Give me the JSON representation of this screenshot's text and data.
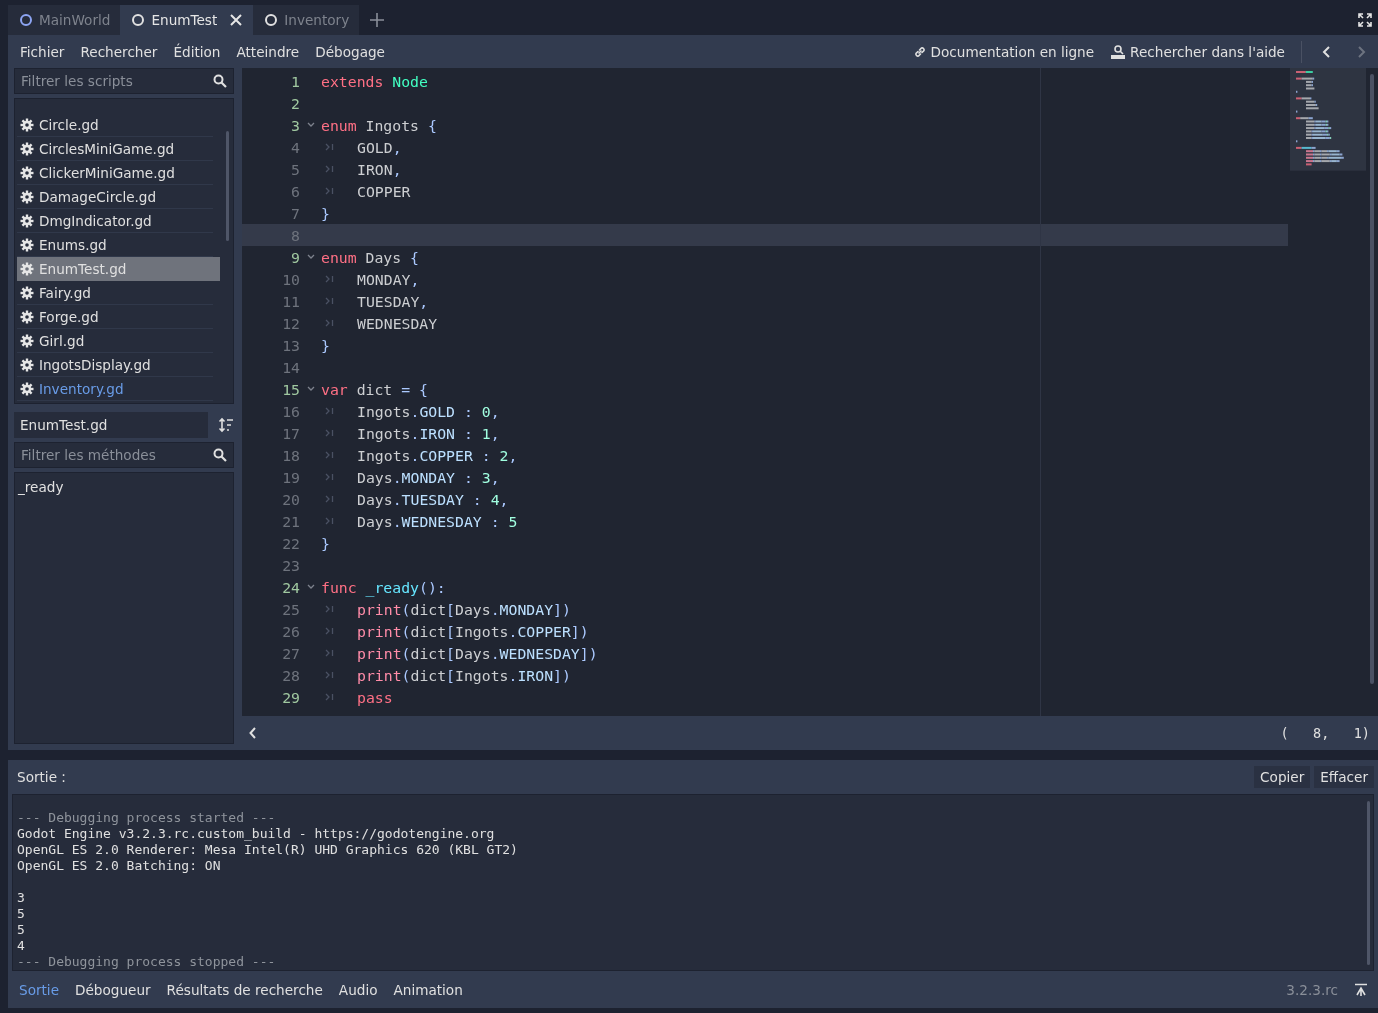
{
  "tabs": [
    {
      "label": "MainWorld",
      "selected": false,
      "color": "#8da5f3"
    },
    {
      "label": "EnumTest",
      "selected": true,
      "color": "#e0e0e0"
    },
    {
      "label": "Inventory",
      "selected": false,
      "color": "#e0e0e0"
    }
  ],
  "menu": [
    "Fichier",
    "Rechercher",
    "Édition",
    "Atteindre",
    "Débogage"
  ],
  "help_links": [
    {
      "label": "Documentation en ligne",
      "kind": "link"
    },
    {
      "label": "Rechercher dans l'aide",
      "kind": "search"
    }
  ],
  "history_nav": [
    {
      "disabled": false
    },
    {
      "disabled": true
    }
  ],
  "script_filter": {
    "placeholder": "Filtrer les scripts"
  },
  "scripts": [
    {
      "name": "Circle.gd",
      "selected": false,
      "highlighted": false
    },
    {
      "name": "CirclesMiniGame.gd",
      "selected": false,
      "highlighted": false
    },
    {
      "name": "ClickerMiniGame.gd",
      "selected": false,
      "highlighted": false
    },
    {
      "name": "DamageCircle.gd",
      "selected": false,
      "highlighted": false
    },
    {
      "name": "DmgIndicator.gd",
      "selected": false,
      "highlighted": false
    },
    {
      "name": "Enums.gd",
      "selected": false,
      "highlighted": false
    },
    {
      "name": "EnumTest.gd",
      "selected": true,
      "highlighted": false
    },
    {
      "name": "Fairy.gd",
      "selected": false,
      "highlighted": false
    },
    {
      "name": "Forge.gd",
      "selected": false,
      "highlighted": false
    },
    {
      "name": "Girl.gd",
      "selected": false,
      "highlighted": false
    },
    {
      "name": "IngotsDisplay.gd",
      "selected": false,
      "highlighted": false
    },
    {
      "name": "Inventory.gd",
      "selected": false,
      "highlighted": true
    }
  ],
  "current_script": "EnumTest.gd",
  "method_filter": {
    "placeholder": "Filtrer les méthodes"
  },
  "methods": [
    "_ready"
  ],
  "code_lines": [
    {
      "number": "1",
      "safe": true,
      "fold": false,
      "indent": false,
      "current": false,
      "tokens": [
        {
          "text": "extends",
          "kind": "keyword"
        },
        {
          "text": " Node",
          "kind": "type"
        }
      ]
    },
    {
      "number": "2",
      "safe": true,
      "fold": false,
      "indent": false,
      "current": false
    },
    {
      "number": "3",
      "safe": true,
      "fold": true,
      "indent": false,
      "current": false,
      "tokens": [
        {
          "text": "enum",
          "kind": "keyword"
        },
        {
          "text": " Ingots ",
          "kind": "plain"
        },
        {
          "text": "{",
          "kind": "symbol"
        }
      ]
    },
    {
      "number": "4",
      "safe": false,
      "fold": false,
      "indent": true,
      "current": false,
      "tokens": [
        {
          "text": "GOLD",
          "kind": "plain"
        },
        {
          "text": ",",
          "kind": "symbol"
        }
      ]
    },
    {
      "number": "5",
      "safe": false,
      "fold": false,
      "indent": true,
      "current": false,
      "tokens": [
        {
          "text": "IRON",
          "kind": "plain"
        },
        {
          "text": ",",
          "kind": "symbol"
        }
      ]
    },
    {
      "number": "6",
      "safe": false,
      "fold": false,
      "indent": true,
      "current": false,
      "tokens": [
        {
          "text": "COPPER",
          "kind": "plain"
        }
      ]
    },
    {
      "number": "7",
      "safe": false,
      "fold": false,
      "indent": false,
      "current": false,
      "tokens": [
        {
          "text": "}",
          "kind": "symbol"
        }
      ]
    },
    {
      "number": "8",
      "safe": false,
      "fold": false,
      "indent": false,
      "current": true
    },
    {
      "number": "9",
      "safe": true,
      "fold": true,
      "indent": false,
      "current": false,
      "tokens": [
        {
          "text": "enum",
          "kind": "keyword"
        },
        {
          "text": " Days ",
          "kind": "plain"
        },
        {
          "text": "{",
          "kind": "symbol"
        }
      ]
    },
    {
      "number": "10",
      "safe": false,
      "fold": false,
      "indent": true,
      "current": false,
      "tokens": [
        {
          "text": "MONDAY",
          "kind": "plain"
        },
        {
          "text": ",",
          "kind": "symbol"
        }
      ]
    },
    {
      "number": "11",
      "safe": false,
      "fold": false,
      "indent": true,
      "current": false,
      "tokens": [
        {
          "text": "TUESDAY",
          "kind": "plain"
        },
        {
          "text": ",",
          "kind": "symbol"
        }
      ]
    },
    {
      "number": "12",
      "safe": false,
      "fold": false,
      "indent": true,
      "current": false,
      "tokens": [
        {
          "text": "WEDNESDAY",
          "kind": "plain"
        }
      ]
    },
    {
      "number": "13",
      "safe": false,
      "fold": false,
      "indent": false,
      "current": false,
      "tokens": [
        {
          "text": "}",
          "kind": "symbol"
        }
      ]
    },
    {
      "number": "14",
      "safe": false,
      "fold": false,
      "indent": false,
      "current": false
    },
    {
      "number": "15",
      "safe": true,
      "fold": true,
      "indent": false,
      "current": false,
      "tokens": [
        {
          "text": "var",
          "kind": "keyword"
        },
        {
          "text": " dict ",
          "kind": "plain"
        },
        {
          "text": "= {",
          "kind": "symbol"
        }
      ]
    },
    {
      "number": "16",
      "safe": false,
      "fold": false,
      "indent": true,
      "current": false,
      "tokens": [
        {
          "text": "Ingots",
          "kind": "plain"
        },
        {
          "text": ".",
          "kind": "symbol"
        },
        {
          "text": "GOLD",
          "kind": "member"
        },
        {
          "text": " : ",
          "kind": "symbol"
        },
        {
          "text": "0",
          "kind": "number"
        },
        {
          "text": ",",
          "kind": "symbol"
        }
      ]
    },
    {
      "number": "17",
      "safe": false,
      "fold": false,
      "indent": true,
      "current": false,
      "tokens": [
        {
          "text": "Ingots",
          "kind": "plain"
        },
        {
          "text": ".",
          "kind": "symbol"
        },
        {
          "text": "IRON",
          "kind": "member"
        },
        {
          "text": " : ",
          "kind": "symbol"
        },
        {
          "text": "1",
          "kind": "number"
        },
        {
          "text": ",",
          "kind": "symbol"
        }
      ]
    },
    {
      "number": "18",
      "safe": false,
      "fold": false,
      "indent": true,
      "current": false,
      "tokens": [
        {
          "text": "Ingots",
          "kind": "plain"
        },
        {
          "text": ".",
          "kind": "symbol"
        },
        {
          "text": "COPPER",
          "kind": "member"
        },
        {
          "text": " : ",
          "kind": "symbol"
        },
        {
          "text": "2",
          "kind": "number"
        },
        {
          "text": ",",
          "kind": "symbol"
        }
      ]
    },
    {
      "number": "19",
      "safe": false,
      "fold": false,
      "indent": true,
      "current": false,
      "tokens": [
        {
          "text": "Days",
          "kind": "plain"
        },
        {
          "text": ".",
          "kind": "symbol"
        },
        {
          "text": "MONDAY",
          "kind": "member"
        },
        {
          "text": " : ",
          "kind": "symbol"
        },
        {
          "text": "3",
          "kind": "number"
        },
        {
          "text": ",",
          "kind": "symbol"
        }
      ]
    },
    {
      "number": "20",
      "safe": false,
      "fold": false,
      "indent": true,
      "current": false,
      "tokens": [
        {
          "text": "Days",
          "kind": "plain"
        },
        {
          "text": ".",
          "kind": "symbol"
        },
        {
          "text": "TUESDAY",
          "kind": "member"
        },
        {
          "text": " : ",
          "kind": "symbol"
        },
        {
          "text": "4",
          "kind": "number"
        },
        {
          "text": ",",
          "kind": "symbol"
        }
      ]
    },
    {
      "number": "21",
      "safe": false,
      "fold": false,
      "indent": true,
      "current": false,
      "tokens": [
        {
          "text": "Days",
          "kind": "plain"
        },
        {
          "text": ".",
          "kind": "symbol"
        },
        {
          "text": "WEDNESDAY",
          "kind": "member"
        },
        {
          "text": " : ",
          "kind": "symbol"
        },
        {
          "text": "5",
          "kind": "number"
        }
      ]
    },
    {
      "number": "22",
      "safe": false,
      "fold": false,
      "indent": false,
      "current": false,
      "tokens": [
        {
          "text": "}",
          "kind": "symbol"
        }
      ]
    },
    {
      "number": "23",
      "safe": false,
      "fold": false,
      "indent": false,
      "current": false
    },
    {
      "number": "24",
      "safe": true,
      "fold": true,
      "indent": false,
      "current": false,
      "tokens": [
        {
          "text": "func",
          "kind": "keyword"
        },
        {
          "text": " _ready",
          "kind": "function"
        },
        {
          "text": "():",
          "kind": "symbol"
        }
      ]
    },
    {
      "number": "25",
      "safe": false,
      "fold": false,
      "indent": true,
      "current": false,
      "tokens": [
        {
          "text": "print",
          "kind": "builtin"
        },
        {
          "text": "(",
          "kind": "symbol"
        },
        {
          "text": "dict",
          "kind": "plain"
        },
        {
          "text": "[",
          "kind": "symbol"
        },
        {
          "text": "Days",
          "kind": "plain"
        },
        {
          "text": ".",
          "kind": "symbol"
        },
        {
          "text": "MONDAY",
          "kind": "member"
        },
        {
          "text": "])",
          "kind": "symbol"
        }
      ]
    },
    {
      "number": "26",
      "safe": false,
      "fold": false,
      "indent": true,
      "current": false,
      "tokens": [
        {
          "text": "print",
          "kind": "builtin"
        },
        {
          "text": "(",
          "kind": "symbol"
        },
        {
          "text": "dict",
          "kind": "plain"
        },
        {
          "text": "[",
          "kind": "symbol"
        },
        {
          "text": "Ingots",
          "kind": "plain"
        },
        {
          "text": ".",
          "kind": "symbol"
        },
        {
          "text": "COPPER",
          "kind": "member"
        },
        {
          "text": "])",
          "kind": "symbol"
        }
      ]
    },
    {
      "number": "27",
      "safe": false,
      "fold": false,
      "indent": true,
      "current": false,
      "tokens": [
        {
          "text": "print",
          "kind": "builtin"
        },
        {
          "text": "(",
          "kind": "symbol"
        },
        {
          "text": "dict",
          "kind": "plain"
        },
        {
          "text": "[",
          "kind": "symbol"
        },
        {
          "text": "Days",
          "kind": "plain"
        },
        {
          "text": ".",
          "kind": "symbol"
        },
        {
          "text": "WEDNESDAY",
          "kind": "member"
        },
        {
          "text": "])",
          "kind": "symbol"
        }
      ]
    },
    {
      "number": "28",
      "safe": false,
      "fold": false,
      "indent": true,
      "current": false,
      "tokens": [
        {
          "text": "print",
          "kind": "builtin"
        },
        {
          "text": "(",
          "kind": "symbol"
        },
        {
          "text": "dict",
          "kind": "plain"
        },
        {
          "text": "[",
          "kind": "symbol"
        },
        {
          "text": "Ingots",
          "kind": "plain"
        },
        {
          "text": ".",
          "kind": "symbol"
        },
        {
          "text": "IRON",
          "kind": "member"
        },
        {
          "text": "])",
          "kind": "symbol"
        }
      ]
    },
    {
      "number": "29",
      "safe": true,
      "fold": false,
      "indent": true,
      "current": false,
      "tokens": [
        {
          "text": "pass",
          "kind": "keyword"
        }
      ]
    }
  ],
  "cursor_position": "(   8,   1)",
  "output": {
    "title": "Sortie :",
    "buttons": [
      "Copier",
      "Effacer"
    ],
    "lines": [
      {
        "text": "--- Debugging process started ---",
        "kind": "meta",
        "gap_before": false
      },
      {
        "text": "Godot Engine v3.2.3.rc.custom_build - https://godotengine.org",
        "kind": "text",
        "gap_before": false
      },
      {
        "text": "OpenGL ES 2.0 Renderer: Mesa Intel(R) UHD Graphics 620 (KBL GT2)",
        "kind": "text",
        "gap_before": false
      },
      {
        "text": "OpenGL ES 2.0 Batching: ON",
        "kind": "text",
        "gap_before": false
      },
      {
        "text": "3",
        "kind": "text",
        "gap_before": true
      },
      {
        "text": "5",
        "kind": "text",
        "gap_before": false
      },
      {
        "text": "5",
        "kind": "text",
        "gap_before": false
      },
      {
        "text": "4",
        "kind": "text",
        "gap_before": false
      },
      {
        "text": "--- Debugging process stopped ---",
        "kind": "meta",
        "gap_before": false
      }
    ]
  },
  "bottom_tabs": [
    {
      "label": "Sortie",
      "selected": true
    },
    {
      "label": "Débogueur",
      "selected": false
    },
    {
      "label": "Résultats de recherche",
      "selected": false
    },
    {
      "label": "Audio",
      "selected": false
    },
    {
      "label": "Animation",
      "selected": false
    }
  ],
  "version": "3.2.3.rc"
}
